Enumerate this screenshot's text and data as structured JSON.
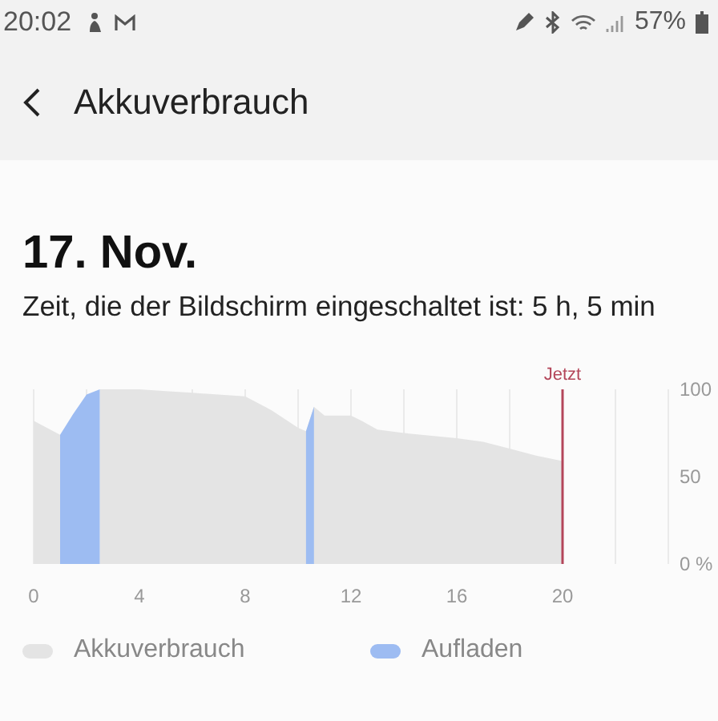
{
  "status_bar": {
    "time": "20:02",
    "battery": "57%"
  },
  "header": {
    "title": "Akkuverbrauch"
  },
  "date": "17. Nov.",
  "screen_time": "Zeit, die der Bildschirm eingeschaltet ist: 5 h, 5 min",
  "chart_data": {
    "type": "area",
    "x": [
      0,
      1,
      1.5,
      2,
      2.5,
      3,
      4,
      5,
      6,
      8,
      9,
      10,
      10.3,
      10.6,
      11,
      12,
      12.4,
      13,
      14,
      16,
      17,
      18,
      19,
      20
    ],
    "series": [
      {
        "name": "Akkuverbrauch",
        "color": "#e4e4e4",
        "values": [
          82,
          74,
          null,
          null,
          100,
          100,
          100,
          99,
          98,
          96,
          88,
          78,
          76,
          90,
          85,
          85,
          82,
          77,
          75,
          72,
          70,
          66,
          62,
          59
        ]
      },
      {
        "name": "Aufladen",
        "color": "#9dbcf2",
        "values": [
          null,
          74,
          86,
          97,
          100,
          null,
          null,
          null,
          null,
          null,
          null,
          null,
          76,
          90,
          null,
          null,
          null,
          null,
          null,
          null,
          null,
          null,
          null,
          null
        ]
      }
    ],
    "xlim": [
      0,
      24
    ],
    "ylim": [
      0,
      100
    ],
    "xticks": [
      0,
      4,
      8,
      12,
      16,
      20
    ],
    "yticks": [
      {
        "value": 0,
        "label": "0 %"
      },
      50,
      100
    ],
    "grid": true,
    "annotations": [
      {
        "x": 20,
        "text": "Jetzt"
      }
    ]
  }
}
